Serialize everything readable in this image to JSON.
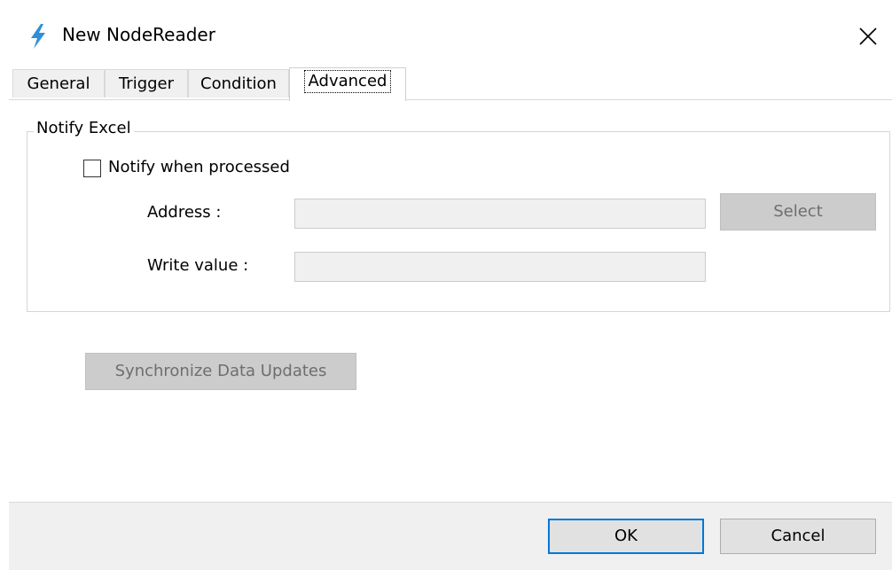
{
  "window": {
    "title": "New NodeReader",
    "title_icon": "lightning-bolt-icon",
    "close_icon": "close-icon",
    "accent_color": "#0078d7"
  },
  "tabs": [
    {
      "label": "General",
      "selected": false
    },
    {
      "label": "Trigger",
      "selected": false
    },
    {
      "label": "Condition",
      "selected": false
    },
    {
      "label": "Advanced",
      "selected": true
    }
  ],
  "notify_group": {
    "legend": "Notify Excel",
    "checkbox_label": "Notify when processed",
    "checked": false,
    "address_label": "Address :",
    "address_value": "",
    "write_value_label": "Write value :",
    "write_value_value": "",
    "select_label": "Select"
  },
  "sync_button_label": "Synchronize Data Updates",
  "footer": {
    "ok_label": "OK",
    "cancel_label": "Cancel"
  }
}
